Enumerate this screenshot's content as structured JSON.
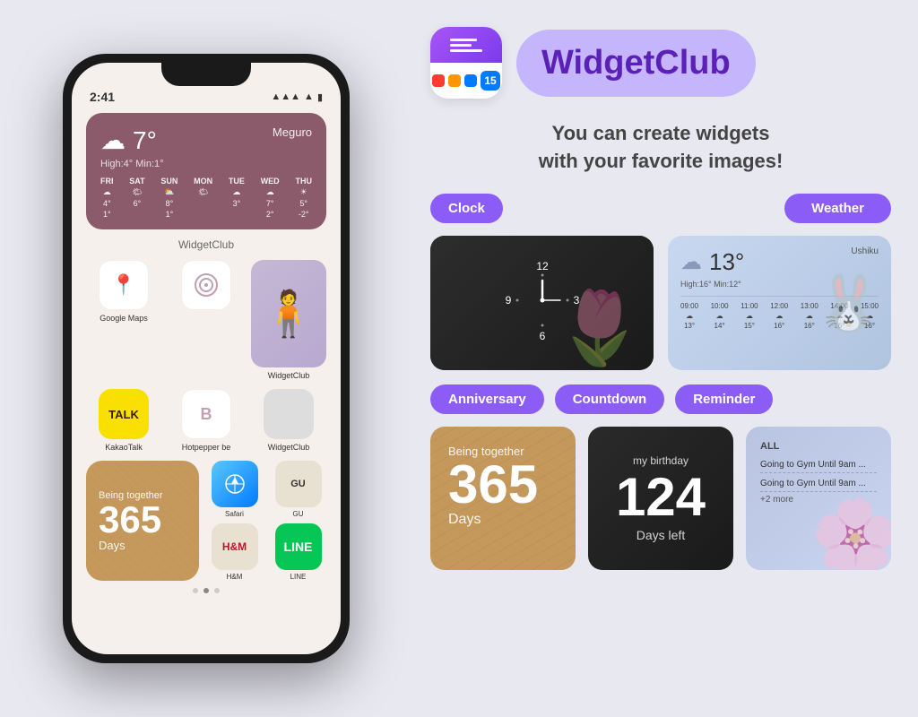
{
  "background_color": "#e8e8f0",
  "left": {
    "phone": {
      "time": "2:41",
      "weather": {
        "temp": "7°",
        "location": "Meguro",
        "minmax": "High:4° Min:1°",
        "days": [
          {
            "name": "FRI",
            "icon": "☁",
            "high": "4°",
            "low": "1°"
          },
          {
            "name": "SAT",
            "icon": "🌤",
            "high": "6°",
            "low": ""
          },
          {
            "name": "SUN",
            "icon": "⛅",
            "high": "8°",
            "low": "1°"
          },
          {
            "name": "MON",
            "icon": "🌤",
            "high": "",
            "low": ""
          },
          {
            "name": "TUE",
            "icon": "☁",
            "high": "3°",
            "low": ""
          },
          {
            "name": "WED",
            "icon": "☁",
            "high": "7°",
            "low": "2°"
          },
          {
            "name": "THU",
            "icon": "☀",
            "high": "5°",
            "low": "-2°"
          }
        ]
      },
      "widgetclub_label": "WidgetClub",
      "apps": [
        {
          "name": "Google Maps",
          "icon": "📍"
        },
        {
          "name": "",
          "icon": ""
        },
        {
          "name": "WidgetClub",
          "icon": ""
        }
      ],
      "apps2": [
        {
          "name": "KakaoTalk",
          "icon": "TALK"
        },
        {
          "name": "Hotpepper be",
          "icon": "B"
        },
        {
          "name": "WidgetClub",
          "icon": ""
        }
      ],
      "anniversary": {
        "label": "Being together",
        "number": "365",
        "days": "Days"
      },
      "small_apps": [
        {
          "name": "Safari",
          "type": "safari"
        },
        {
          "name": "H&M",
          "type": "hm"
        },
        {
          "name": "GU",
          "type": "gu"
        },
        {
          "name": "LINE",
          "type": "line"
        }
      ],
      "dots": 3,
      "active_dot": 1
    }
  },
  "right": {
    "logo": {
      "lines": [
        "30px",
        "24px",
        "36px"
      ],
      "dots": [
        "red",
        "orange",
        "blue"
      ],
      "number": "15"
    },
    "app_name": "WidgetClub",
    "tagline_line1": "You can create widgets",
    "tagline_line2": "with your favorite images!",
    "categories": [
      {
        "label": "Clock",
        "id": "clock"
      },
      {
        "label": "Weather",
        "id": "weather"
      },
      {
        "label": "Anniversary",
        "id": "anniversary"
      },
      {
        "label": "Countdown",
        "id": "countdown"
      },
      {
        "label": "Reminder",
        "id": "reminder"
      }
    ],
    "clock_widget": {
      "numbers": [
        "12",
        "3",
        "6",
        "9"
      ]
    },
    "weather_widget": {
      "temp": "13°",
      "location": "Ushiku",
      "minmax": "High:16° Min:12°",
      "hours": [
        {
          "time": "09:00",
          "icon": "☁",
          "temp": "13°"
        },
        {
          "time": "10:00",
          "icon": "☁",
          "temp": "14°"
        },
        {
          "time": "11:00",
          "icon": "☁",
          "temp": "15°"
        },
        {
          "time": "12:00",
          "icon": "☁",
          "temp": "16°"
        },
        {
          "time": "13:00",
          "icon": "☁",
          "temp": "16°"
        },
        {
          "time": "14:00",
          "icon": "☁",
          "temp": "16°"
        },
        {
          "time": "15:00",
          "icon": "☁",
          "temp": "16°"
        }
      ]
    },
    "anniversary_widget": {
      "label": "Being together",
      "number": "365",
      "days": "Days"
    },
    "countdown_widget": {
      "title": "my birthday",
      "number": "124",
      "label": "Days left"
    },
    "reminder_widget": {
      "all_label": "ALL",
      "items": [
        "Going to Gym Until 9am ...",
        "Going to Gym Until 9am ..."
      ],
      "more": "+2 more"
    }
  }
}
